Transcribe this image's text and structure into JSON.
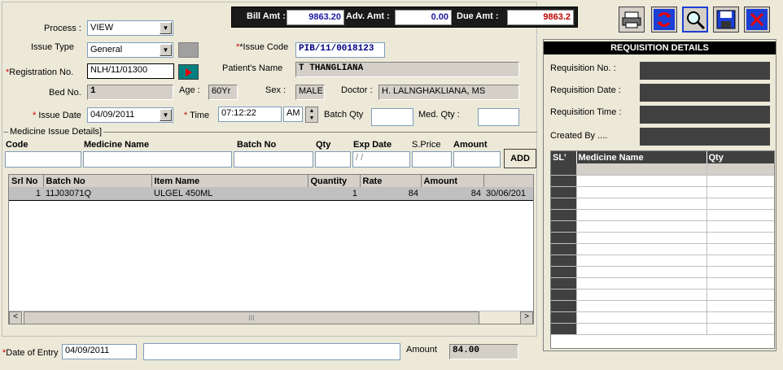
{
  "header": {
    "bill_amt_label": "Bill Amt :",
    "bill_amt_value": "9863.20",
    "adv_amt_label": "Adv. Amt :",
    "adv_amt_value": "0.00",
    "due_amt_label": "Due  Amt :",
    "due_amt_value": "9863.2"
  },
  "toolbar": [
    "print-icon",
    "refresh-icon",
    "search-icon",
    "save-icon",
    "close-icon"
  ],
  "form": {
    "process_label": "Process :",
    "process_value": "VIEW",
    "issue_type_label": "Issue Type",
    "issue_type_value": "General",
    "issue_code_label": "*Issue Code",
    "issue_code_value": "PIB/11/0018123",
    "reg_no_label": "Registration No.",
    "reg_no_value": "NLH/11/01300",
    "patient_name_label": "Patient's  Name",
    "patient_name_value": "T THANGLIANA",
    "bed_no_label": "Bed No.",
    "bed_no_value": "1",
    "age_label": "Age :",
    "age_value": "60Yr",
    "sex_label": "Sex :",
    "sex_value": "MALE",
    "doctor_label": "Doctor :",
    "doctor_value": "H. LALNGHAKLIANA, MS",
    "issue_date_label": "Issue Date",
    "issue_date_value": "04/09/2011",
    "time_label": "Time",
    "time_value": "07:12:22",
    "ampm_value": "AM",
    "batch_qty_label": "Batch Qty",
    "med_qty_label": "Med. Qty :"
  },
  "medicine_issue": {
    "group_label": "Medicine Issue  Details]",
    "code_label": "Code",
    "medicine_name_label": "Medicine Name",
    "batch_no_label": "Batch No",
    "qty_label": "Qty",
    "exp_date_label": "Exp Date",
    "exp_date_placeholder": "/ /",
    "sprice_label": "S.Price",
    "amount_label": "Amount",
    "add_button": "ADD"
  },
  "issue_table": {
    "columns": [
      "Srl No",
      "Batch No",
      "Item Name",
      "Quantity",
      "Rate",
      "Amount",
      ""
    ],
    "rows": [
      [
        "1",
        "11J03071Q",
        "ULGEL  450ML",
        "1",
        "84",
        "84",
        "30/06/201"
      ]
    ],
    "scroll_left": "<",
    "scroll_mid": "III",
    "scroll_right": ">"
  },
  "footer": {
    "date_of_entry_label": "Date of Entry",
    "date_of_entry_value": "04/09/2011",
    "amount_label": "Amount",
    "amount_value": "84.00"
  },
  "requisition": {
    "title": "REQUISITION DETAILS",
    "req_no_label": "Requisition No. :",
    "req_date_label": "Requisition Date :",
    "req_time_label": "Requisition Time :",
    "created_by_label": "Created By ....",
    "columns": [
      "SL'",
      "Medicine Name",
      "Qty"
    ],
    "row_count": 15
  }
}
